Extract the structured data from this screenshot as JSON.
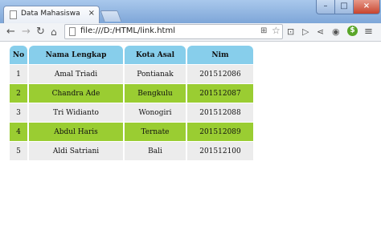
{
  "browser": {
    "tab_title": "Data Mahasiswa",
    "tab_close": "×",
    "url": "file:///D:/HTML/link.html",
    "controls": {
      "minimize": "–",
      "maximize": "□",
      "close": "×"
    }
  },
  "table": {
    "headers": [
      "No",
      "Nama Lengkap",
      "Kota Asal",
      "Nim"
    ],
    "rows": [
      [
        "1",
        "Amal Triadi",
        "Pontianak",
        "201512086"
      ],
      [
        "2",
        "Chandra Ade",
        "Bengkulu",
        "201512087"
      ],
      [
        "3",
        "Tri Widianto",
        "Wonogiri",
        "201512088"
      ],
      [
        "4",
        "Abdul Haris",
        "Ternate",
        "201512089"
      ],
      [
        "5",
        "Aldi Satriani",
        "Bali",
        "201512100"
      ]
    ]
  },
  "colors": {
    "header_bg": "#87ceeb",
    "odd_row_bg": "#ececec",
    "even_row_bg": "#9acd32"
  }
}
